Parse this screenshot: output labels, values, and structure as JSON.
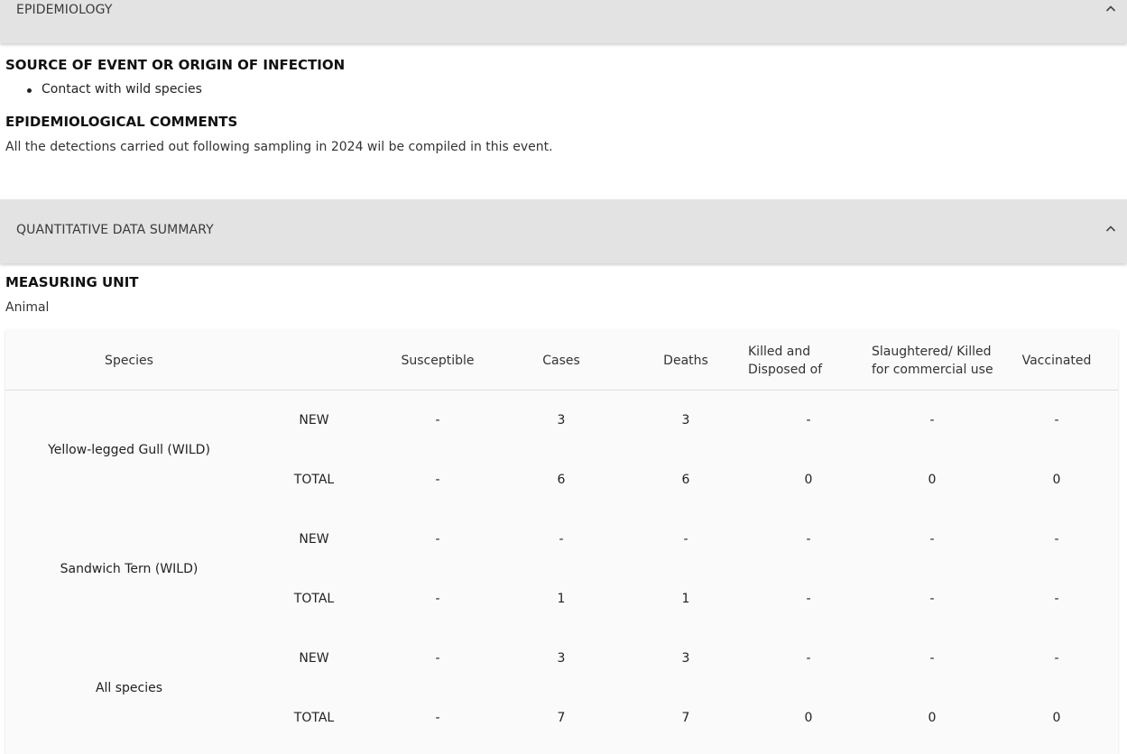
{
  "epidemiology": {
    "header": "EPIDEMIOLOGY",
    "source_title": "SOURCE OF EVENT OR ORIGIN OF INFECTION",
    "sources": [
      "Contact with wild species"
    ],
    "comments_title": "EPIDEMIOLOGICAL COMMENTS",
    "comments_text": "All the detections carried out following sampling in 2024 wil be compiled in this event."
  },
  "quantitative": {
    "header": "QUANTITATIVE DATA SUMMARY",
    "measuring_unit_title": "MEASURING UNIT",
    "measuring_unit": "Animal",
    "columns": {
      "species": "Species",
      "susceptible": "Susceptible",
      "cases": "Cases",
      "deaths": "Deaths",
      "killed": "Killed and Disposed of",
      "slaughtered": "Slaughtered/ Killed for commercial use",
      "vaccinated": "Vaccinated"
    },
    "rows": [
      {
        "species": "Yellow-legged Gull (WILD)",
        "new": {
          "label": "NEW",
          "values": [
            "-",
            "3",
            "3",
            "-",
            "-",
            "-"
          ]
        },
        "total": {
          "label": "TOTAL",
          "values": [
            "-",
            "6",
            "6",
            "0",
            "0",
            "0"
          ]
        }
      },
      {
        "species": "Sandwich Tern (WILD)",
        "new": {
          "label": "NEW",
          "values": [
            "-",
            "-",
            "-",
            "-",
            "-",
            "-"
          ]
        },
        "total": {
          "label": "TOTAL",
          "values": [
            "-",
            "1",
            "1",
            "-",
            "-",
            "-"
          ]
        }
      },
      {
        "species": "All species",
        "new": {
          "label": "NEW",
          "values": [
            "-",
            "3",
            "3",
            "-",
            "-",
            "-"
          ]
        },
        "total": {
          "label": "TOTAL",
          "values": [
            "-",
            "7",
            "7",
            "0",
            "0",
            "0"
          ]
        }
      }
    ]
  },
  "icons": {
    "collapse": "chevron-up-icon",
    "bullet": "bullet-dot"
  },
  "colors": {
    "header_bg": "#e3e3e3",
    "table_bg": "#fafafa"
  }
}
